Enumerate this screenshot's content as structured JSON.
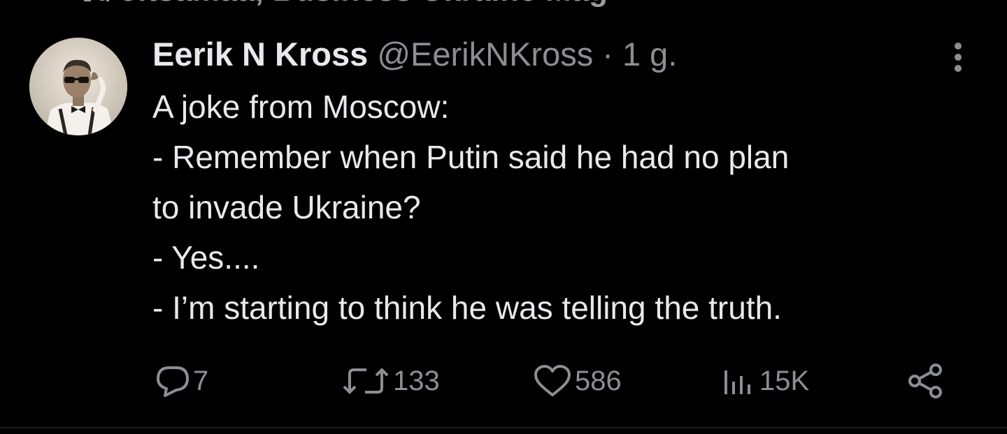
{
  "header_partial": {
    "text": "Pöltsamaa, Business Ukraine Mag"
  },
  "tweet": {
    "display_name": "Eerik N Kross",
    "handle": "@EerikNKross",
    "separator": "·",
    "time": "1 g.",
    "body_lines": [
      "A joke from Moscow:",
      "- Remember when Putin said he had no plan",
      "to invade Ukraine?",
      "- Yes....",
      "- I’m starting to think he was telling the truth."
    ],
    "more_icon": "more-vertical-icon"
  },
  "actions": {
    "reply": {
      "icon": "reply-icon",
      "count": "7"
    },
    "retweet": {
      "icon": "retweet-icon",
      "count": "133"
    },
    "like": {
      "icon": "heart-icon",
      "count": "586"
    },
    "views": {
      "icon": "views-icon",
      "count": "15K"
    },
    "share": {
      "icon": "share-icon"
    }
  },
  "colors": {
    "background": "#000000",
    "primary_text": "#e7e9ea",
    "secondary_text": "#8b8f94"
  }
}
